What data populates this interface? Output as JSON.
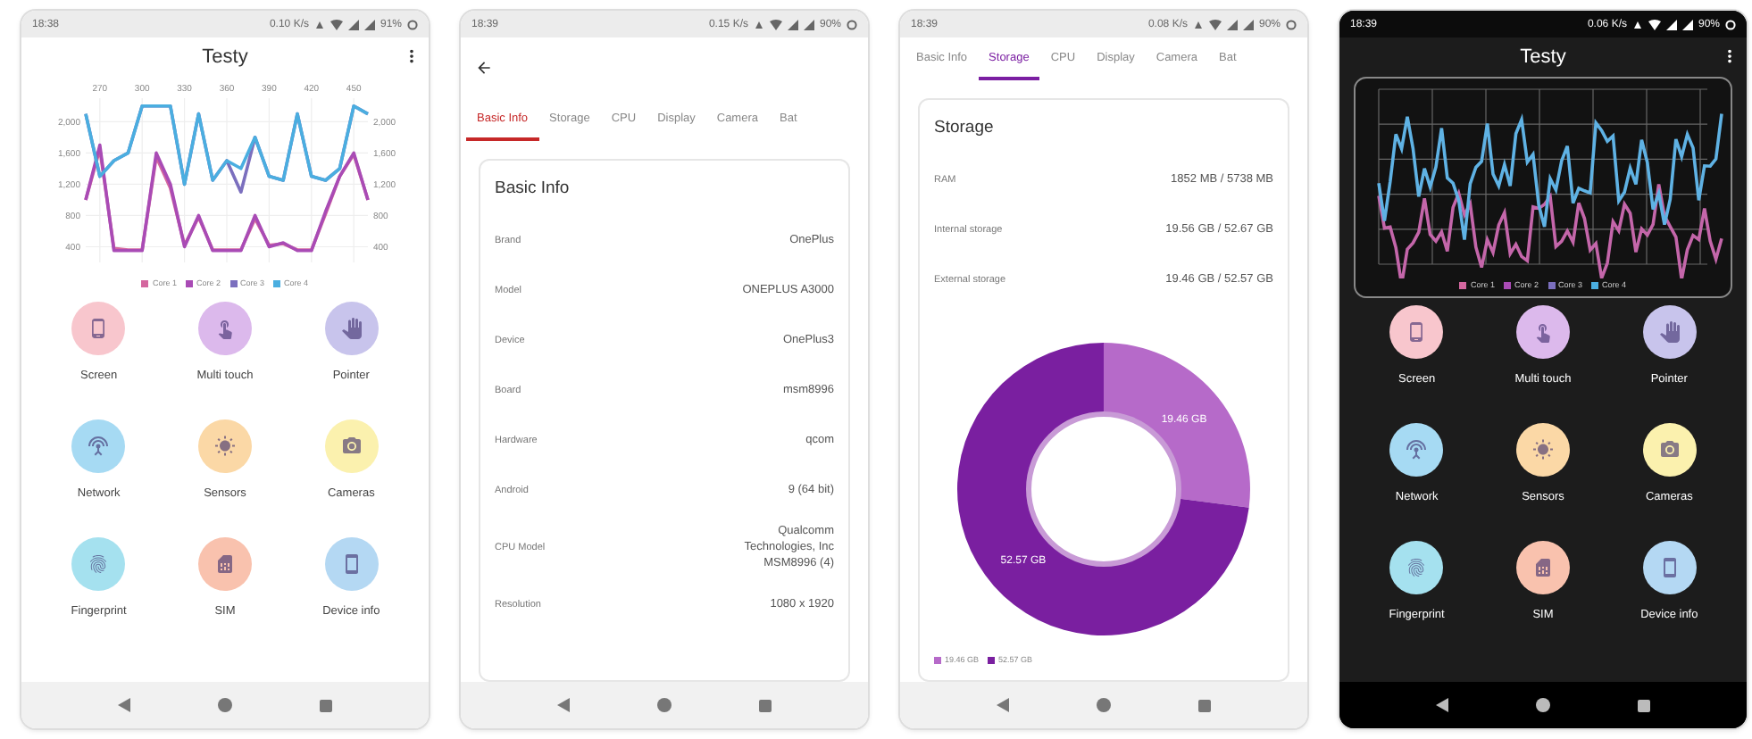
{
  "phones": [
    {
      "kind": "home",
      "dark": false,
      "status": {
        "time": "18:38",
        "speed": "0.10 K/s",
        "battery": "91%"
      },
      "title": "Testy",
      "chart": {
        "chart_data": {
          "type": "line",
          "grid": true,
          "x": [
            260,
            270,
            280,
            290,
            300,
            310,
            320,
            330,
            340,
            350,
            360,
            370,
            380,
            390,
            400,
            410,
            420,
            430,
            440,
            450,
            460
          ],
          "xlim": [
            260,
            460
          ],
          "ylim": [
            200,
            2300
          ],
          "xticks": [
            270,
            300,
            330,
            360,
            390,
            420,
            450
          ],
          "yticks": [
            {
              "value": 400,
              "label": "400"
            },
            {
              "value": 800,
              "label": "800"
            },
            {
              "value": 1200,
              "label": "1,200"
            },
            {
              "value": 1600,
              "label": "1,600"
            },
            {
              "value": 2000,
              "label": "2,000"
            }
          ],
          "series": [
            {
              "name": "Core 1",
              "color": "#d4679f",
              "values": [
                1000,
                1650,
                380,
                360,
                360,
                1550,
                1150,
                420,
                780,
                360,
                360,
                360,
                760,
                420,
                440,
                360,
                360,
                820,
                1300,
                1580,
                1000
              ]
            },
            {
              "name": "Core 2",
              "color": "#a94bb5",
              "values": [
                1000,
                1700,
                350,
                350,
                350,
                1600,
                1200,
                400,
                800,
                350,
                350,
                350,
                800,
                400,
                450,
                350,
                350,
                850,
                1300,
                1600,
                1000
              ]
            },
            {
              "name": "Core 3",
              "color": "#7b6fbe",
              "values": [
                2100,
                1300,
                1500,
                1600,
                2200,
                2200,
                2200,
                1200,
                2100,
                1250,
                1500,
                1100,
                1800,
                1300,
                1250,
                2100,
                1300,
                1250,
                1400,
                2200,
                2100
              ]
            },
            {
              "name": "Core 4",
              "color": "#4aaee0",
              "values": [
                2100,
                1300,
                1500,
                1600,
                2200,
                2200,
                2200,
                1200,
                2100,
                1250,
                1500,
                1400,
                1800,
                1300,
                1250,
                2100,
                1300,
                1250,
                1400,
                2200,
                2100
              ]
            }
          ]
        }
      },
      "tiles": [
        {
          "label": "Screen",
          "color": "#f8c6cd"
        },
        {
          "label": "Multi touch",
          "color": "#dcb9ec"
        },
        {
          "label": "Pointer",
          "color": "#c8c4ec"
        },
        {
          "label": "Network",
          "color": "#a6daf3"
        },
        {
          "label": "Sensors",
          "color": "#fbd8a6"
        },
        {
          "label": "Cameras",
          "color": "#fbf1ae"
        },
        {
          "label": "Fingerprint",
          "color": "#a5e1ef"
        },
        {
          "label": "SIM",
          "color": "#f9c2ae"
        },
        {
          "label": "Device info",
          "color": "#b4d8f3"
        }
      ]
    },
    {
      "kind": "details",
      "color": "#c62828",
      "back": true,
      "status": {
        "time": "18:39",
        "speed": "0.15 K/s",
        "battery": "90%"
      },
      "tabs": [
        {
          "label": "Basic Info",
          "selected": true
        },
        {
          "label": "Storage",
          "selected": false
        },
        {
          "label": "CPU",
          "selected": false
        },
        {
          "label": "Display",
          "selected": false
        },
        {
          "label": "Camera",
          "selected": false
        },
        {
          "label": "Bat",
          "selected": false
        }
      ],
      "card": {
        "title": "Basic Info",
        "rows": [
          {
            "label": "Brand",
            "value": "OnePlus"
          },
          {
            "label": "Model",
            "value": "ONEPLUS A3000"
          },
          {
            "label": "Device",
            "value": "OnePlus3"
          },
          {
            "label": "Board",
            "value": "msm8996"
          },
          {
            "label": "Hardware",
            "value": "qcom"
          },
          {
            "label": "Android",
            "value": "9 (64 bit)"
          },
          {
            "label": "CPU Model",
            "value": "Qualcomm Technologies, Inc MSM8996 (4)"
          },
          {
            "label": "Resolution",
            "value": "1080 x 1920"
          }
        ]
      }
    },
    {
      "kind": "details",
      "color": "#7b1fa2",
      "back": false,
      "status": {
        "time": "18:39",
        "speed": "0.08 K/s",
        "battery": "90%"
      },
      "tabs": [
        {
          "label": "Basic Info",
          "selected": false
        },
        {
          "label": "Storage",
          "selected": true
        },
        {
          "label": "CPU",
          "selected": false
        },
        {
          "label": "Display",
          "selected": false
        },
        {
          "label": "Camera",
          "selected": false
        },
        {
          "label": "Bat",
          "selected": false
        }
      ],
      "card": {
        "title": "Storage",
        "rows": [
          {
            "label": "RAM",
            "value": "1852 MB / 5738 MB"
          },
          {
            "label": "Internal storage",
            "value": "19.56 GB / 52.67 GB"
          },
          {
            "label": "External storage",
            "value": "19.46 GB / 52.57 GB"
          }
        ],
        "chart_data": {
          "type": "donut",
          "categories": [
            "19.46 GB",
            "52.57 GB"
          ],
          "values": [
            19.46,
            52.57
          ],
          "colors": [
            "#b66ac9",
            "#7a1fa0"
          ],
          "value_labels": [
            "19.46 GB",
            "52.57 GB"
          ],
          "legend": "bottom"
        }
      }
    },
    {
      "kind": "home",
      "dark": true,
      "status": {
        "time": "18:39",
        "speed": "0.06 K/s",
        "battery": "90%"
      },
      "title": "Testy",
      "chart": {
        "legend": [
          {
            "name": "Core 1",
            "color": "#d4679f"
          },
          {
            "name": "Core 2",
            "color": "#a94bb5"
          },
          {
            "name": "Core 3",
            "color": "#7b6fbe"
          },
          {
            "name": "Core 4",
            "color": "#4aaee0"
          }
        ]
      },
      "tiles": [
        {
          "label": "Screen",
          "color": "#f8c6cd"
        },
        {
          "label": "Multi touch",
          "color": "#dcb9ec"
        },
        {
          "label": "Pointer",
          "color": "#c8c4ec"
        },
        {
          "label": "Network",
          "color": "#a6daf3"
        },
        {
          "label": "Sensors",
          "color": "#fbd8a6"
        },
        {
          "label": "Cameras",
          "color": "#fbf1ae"
        },
        {
          "label": "Fingerprint",
          "color": "#a5e1ef"
        },
        {
          "label": "SIM",
          "color": "#f9c2ae"
        },
        {
          "label": "Device info",
          "color": "#b4d8f3"
        }
      ]
    }
  ]
}
